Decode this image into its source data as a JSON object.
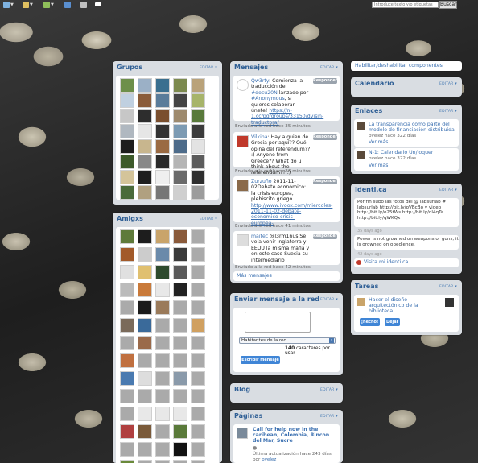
{
  "toolbar": {
    "search_placeholder": "Introduce texto y/o etiquetas",
    "search_button": "Buscar"
  },
  "edit_label": "EDITAR",
  "groups": {
    "title": "Grupos",
    "tile_colors": [
      "#6d8f4a",
      "#9bb0c6",
      "#3a6f8f",
      "#7c8a4e",
      "#b9a27a",
      "#c0d0e0",
      "#8a5c3a",
      "#5a7c9a",
      "#444444",
      "#a7b46a",
      "#c7c7c7",
      "#2d2d2d",
      "#7a4f2e",
      "#9e8a6d",
      "#597a3b",
      "#b0b8c0",
      "#e6e6e6",
      "#333333",
      "#7d9bb3",
      "#3b3b3b",
      "#1d1d1d",
      "#c8b68e",
      "#9a6a42",
      "#4d6b8a",
      "#e3e3e3",
      "#3d5a2a",
      "#888888",
      "#2a2a2a",
      "#b5b5b5",
      "#5c5c5c",
      "#d4c49a",
      "#1f1f1f",
      "#efefef",
      "#6a6a6a",
      "#2e2e2e",
      "#4a6a3a",
      "#b0a080",
      "#777777",
      "#cfcfcf",
      "#9c9c9c"
    ]
  },
  "friends": {
    "title": "Amigxs",
    "tile_colors": [
      "#5e7a3a",
      "#1d1d1d",
      "#c9a46a",
      "#8a5a3a",
      "#aaaaaa",
      "#a25a2a",
      "#cccccc",
      "#6a8aaa",
      "#3a3a3a",
      "#aaaaaa",
      "#e0e0e0",
      "#e0c070",
      "#2d4a2d",
      "#5a5a5a",
      "#aaaaaa",
      "#bbbbbb",
      "#c97a3a",
      "#e8e8e8",
      "#222222",
      "#aaaaaa",
      "#aaaaaa",
      "#1a1a1a",
      "#9a7a5a",
      "#aaaaaa",
      "#aaaaaa",
      "#7a6a5a",
      "#3a6a9a",
      "#aaaaaa",
      "#aaaaaa",
      "#d0a060",
      "#aaaaaa",
      "#9a6a4a",
      "#aaaaaa",
      "#aaaaaa",
      "#aaaaaa",
      "#c07040",
      "#aaaaaa",
      "#aaaaaa",
      "#aaaaaa",
      "#aaaaaa",
      "#4a7ab0",
      "#dddddd",
      "#aaaaaa",
      "#8a9aaa",
      "#aaaaaa",
      "#aaaaaa",
      "#aaaaaa",
      "#aaaaaa",
      "#aaaaaa",
      "#aaaaaa",
      "#aaaaaa",
      "#e8e8e8",
      "#e8e8e8",
      "#e8e8e8",
      "#aaaaaa",
      "#b04040",
      "#7a5a3a",
      "#aaaaaa",
      "#5a7a3a",
      "#aaaaaa",
      "#aaaaaa",
      "#aaaaaa",
      "#aaaaaa",
      "#111111",
      "#aaaaaa",
      "#6a8a3a",
      "#aaaaaa",
      "#aaaaaa",
      "#aaaaaa",
      "#aaaaaa"
    ]
  },
  "messages": {
    "title": "Mensajes",
    "reply_label": "Responder",
    "more_label": "Más mensajes",
    "items": [
      {
        "pre": "",
        "user": "Qw3rty",
        "text": ": Comienza la traducción del ",
        "tag": "#docu20N",
        "text2": " lanzado por ",
        "tag2": "#Anonymous",
        "text3": ", si quieres colaborar únete! ",
        "link": "https://n-1.cc/pg/groups/33150/dvisin-traductora/",
        "meta": "Enviado a la red hace 35 minutos"
      },
      {
        "pre": "",
        "user": "Vilkina",
        "text": ": Hay alguien de Grecia por aquí?? Qué opina del referendum?? :) Anyone from Greece?? What do u think about the referendum?? :)",
        "tag": "",
        "text2": "",
        "tag2": "",
        "text3": "",
        "link": "",
        "meta": "Enviado a la red hace 36 minutos"
      },
      {
        "pre": "",
        "user": "Zurzuño",
        "text": " 2011-11-02Debate económico: la crisis europea, plebiscito griego ",
        "tag": "",
        "text2": "",
        "tag2": "",
        "text3": "",
        "link": "http://www.ivoox.com/miercoles-2011-11-02-debate-economico-crisis-europea-",
        "meta": "Enviado a la red hace 41 minutos"
      },
      {
        "pre": "",
        "user": "maitec",
        "text": " @l3rm1nus Se veía venir Inglaterra y EEUU la misma mafia y en este caso Suecia su intermediario",
        "tag": "",
        "text2": "",
        "tag2": "",
        "text3": "",
        "link": "",
        "meta": "Enviado a la red hace 42 minutos"
      }
    ]
  },
  "send": {
    "title": "Enviar mensaje a la red",
    "select_value": "Habitantes de la red",
    "counter": "140",
    "counter_suffix": " caracteres por usar",
    "button": "Escribir mensaje"
  },
  "blog": {
    "title": "Blog"
  },
  "pages": {
    "title": "Páginas",
    "item_title": "Call for help now in the caribean, Colombia, Rincon del Mar, Sucre",
    "item_meta": "Última actualización hace 243 días por",
    "item_user": "pvelez"
  },
  "toggle_components": "Habilitar/deshabilitar componentes",
  "calendar": {
    "title": "Calendario"
  },
  "links": {
    "title": "Enlaces",
    "items": [
      {
        "title": "La transparencia como parte del modelo de financiación distribuida",
        "meta": "pvelez hace 322 días",
        "more": "Ver más"
      },
      {
        "title": "N-1: Calendario Un/loquer",
        "meta": "pvelez hace 322 días",
        "more": "Ver más"
      }
    ]
  },
  "identica": {
    "title": "Identi.ca",
    "post1": "Por fin subo las fotos del @ labsurlab # labsurlab  http://bit.ly/oVBcBo y video  http://bit.ly/o25tWs  http://bit.ly/ql4qTa  http://bit.ly/qWKQx",
    "time1": "35 days ago",
    "post2": "Power is not growned on weapons or guns; it is growned on obedience.",
    "time2": "42 days ago",
    "visit": "Visita mi identi.ca"
  },
  "tasks": {
    "title": "Tareas",
    "item": "Hacer el diseño arquitectónico de la biblioteca",
    "btn_done": "¡hecho!",
    "btn_leave": "Dejar"
  }
}
